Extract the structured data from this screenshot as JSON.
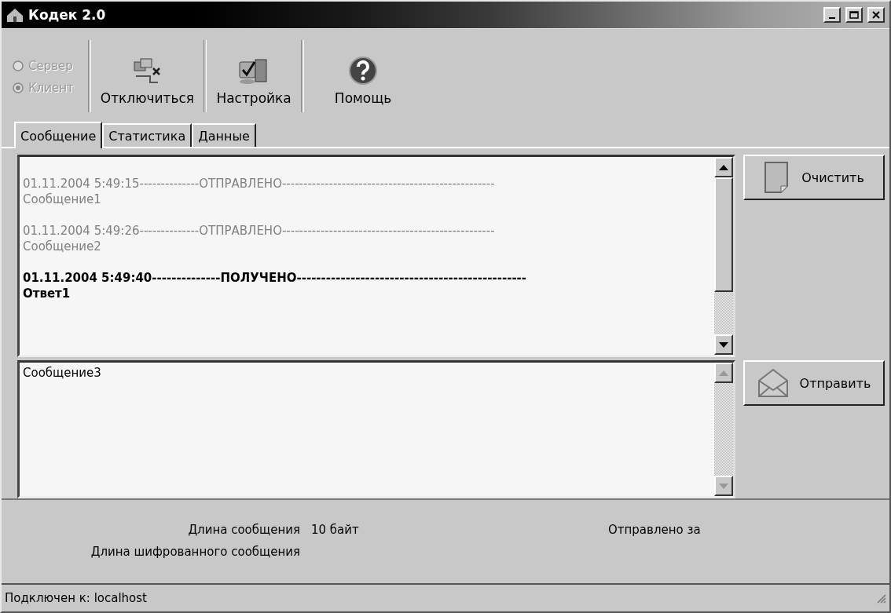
{
  "window": {
    "title": "Кодек 2.0"
  },
  "mode": [
    {
      "label": "Сервер",
      "selected": false,
      "disabled": true
    },
    {
      "label": "Клиент",
      "selected": true,
      "disabled": true
    }
  ],
  "toolbar": [
    {
      "kind": "disconnect",
      "label": "Отключиться"
    },
    {
      "kind": "settings",
      "label": "Настройка"
    },
    {
      "kind": "help",
      "label": "Помощь"
    }
  ],
  "tabs": [
    {
      "label": "Сообщение",
      "selected": true
    },
    {
      "label": "Статистика",
      "selected": false
    },
    {
      "label": "Данные",
      "selected": false
    }
  ],
  "log": [
    {
      "kind": "sent",
      "header": "01.11.2004 5:49:15--------------ОТПРАВЛЕНО--------------------------------------------------",
      "text": "Сообщение1"
    },
    {
      "kind": "sent",
      "header": "01.11.2004 5:49:26--------------ОТПРАВЛЕНО--------------------------------------------------",
      "text": "Сообщение2"
    },
    {
      "kind": "received",
      "header": "01.11.2004 5:49:40--------------ПОЛУЧЕНО-----------------------------------------------",
      "text": "Ответ1"
    }
  ],
  "input": {
    "value": "Сообщение3"
  },
  "buttons": [
    {
      "kind": "clear",
      "label": "Очистить"
    },
    {
      "kind": "send",
      "label": "Отправить"
    }
  ],
  "info": {
    "length_label": "Длина сообщения",
    "length_value": "10 байт",
    "encrypted_label": "Длина шифрованного сообщения",
    "sent_label": "Отправлено за"
  },
  "status_bar": "Подключен к: localhost"
}
